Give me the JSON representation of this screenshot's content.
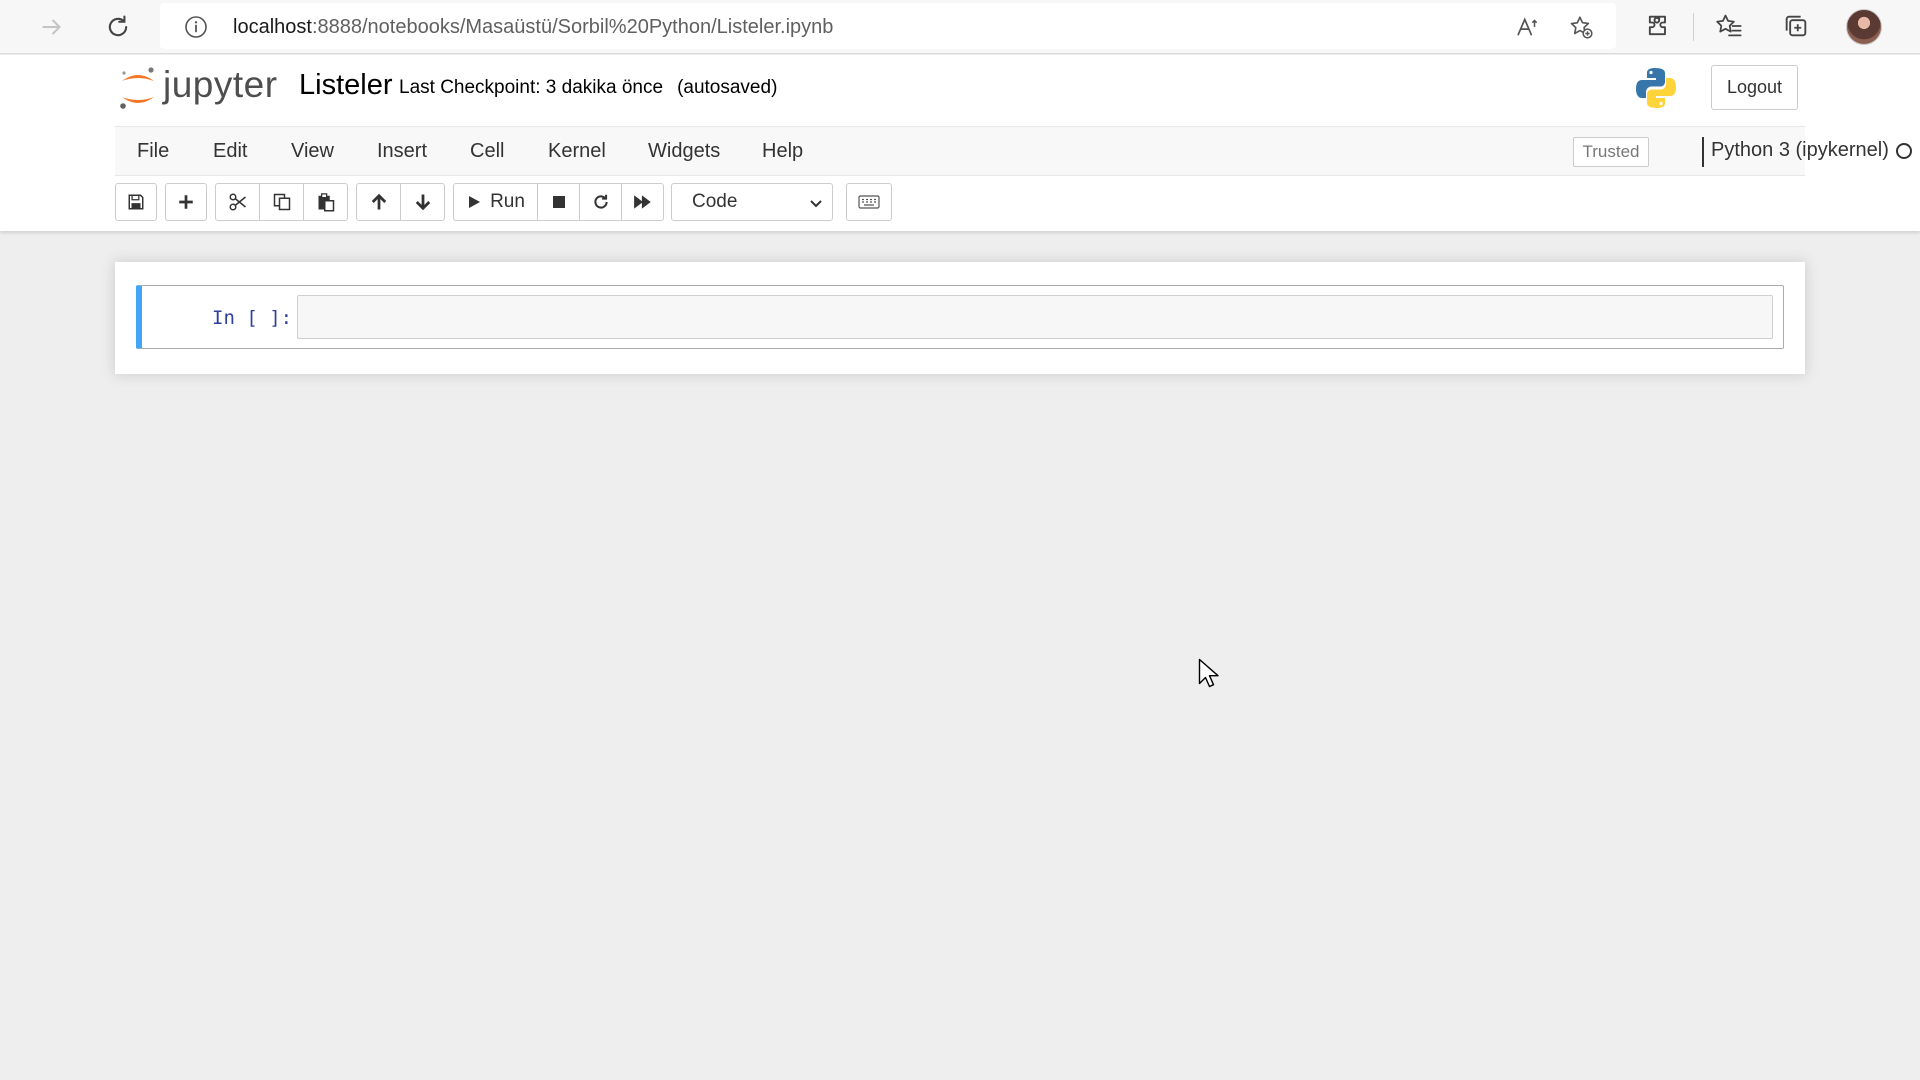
{
  "browser": {
    "url_host": "localhost",
    "url_rest": ":8888/notebooks/Masaüstü/Sorbil%20Python/Listeler.ipynb",
    "icons": [
      "forward-icon",
      "refresh-icon",
      "info-icon",
      "read-aloud-icon",
      "add-favorite-icon",
      "extensions-icon",
      "favorites-icon",
      "collections-icon",
      "profile-avatar"
    ]
  },
  "header": {
    "logo_text": "jupyter",
    "notebook_title": "Listeler",
    "checkpoint": "Last Checkpoint: 3 dakika önce",
    "autosave": "(autosaved)",
    "logout_label": "Logout"
  },
  "menubar": {
    "items": [
      "File",
      "Edit",
      "View",
      "Insert",
      "Cell",
      "Kernel",
      "Widgets",
      "Help"
    ],
    "trusted_label": "Trusted",
    "kernel_name": "Python 3 (ipykernel)"
  },
  "toolbar": {
    "run_label": "Run",
    "cell_type": "Code"
  },
  "cells": [
    {
      "prompt": "In [ ]:",
      "source": ""
    }
  ],
  "colors": {
    "selected_cell_border": "#42a5f5",
    "prompt_color": "#303f9f",
    "jupyter_orange": "#f37726"
  }
}
